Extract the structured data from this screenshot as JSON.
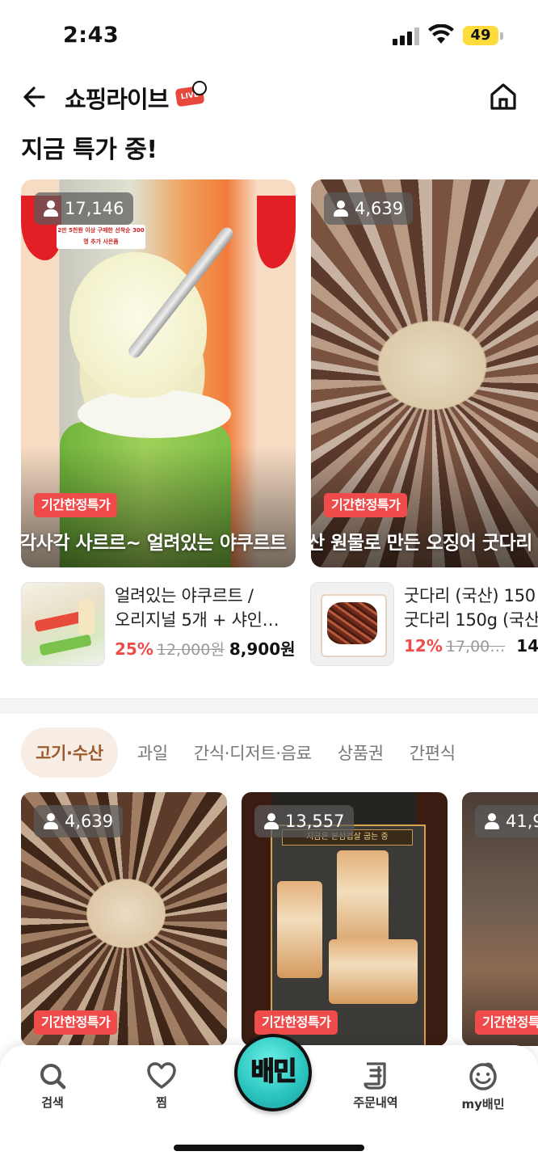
{
  "status_bar": {
    "time": "2:43",
    "battery": "49"
  },
  "header": {
    "title": "쇼핑라이브",
    "live_badge": "LIVE"
  },
  "section": {
    "title": "지금 특가 중!"
  },
  "featured": [
    {
      "viewers": "17,146",
      "badge": "기간한정특가",
      "title": "각사각 사르르~ 얼려있는 야쿠르트",
      "promo": "2만 5천원 이상 구매한 선착순 300명 추가 사은품"
    },
    {
      "viewers": "4,639",
      "badge": "기간한정특가",
      "title": "산 원물로 만든 오징어 굿다리"
    }
  ],
  "products": [
    {
      "name_line1": "얼려있는 야쿠르트 /",
      "name_line2": "오리지널 5개 + 샤인…",
      "discount": "25%",
      "original_price": "12,000원",
      "sale_price": "8,900원"
    },
    {
      "name_line1": "굿다리 (국산) 150",
      "name_line2": "굿다리 150g (국산",
      "discount": "12%",
      "original_price": "17,00…",
      "sale_price": "14,"
    }
  ],
  "tabs": [
    {
      "label": "고기·수산",
      "active": true
    },
    {
      "label": "과일"
    },
    {
      "label": "간식·디저트·음료"
    },
    {
      "label": "상품권"
    },
    {
      "label": "간편식"
    }
  ],
  "live_cards": [
    {
      "viewers": "4,639",
      "badge": "기간한정특가"
    },
    {
      "viewers": "13,557",
      "badge": "기간한정특가",
      "overlay": "지금은 본삼겹살 굽는 중"
    },
    {
      "viewers": "41,9",
      "badge": "기간한정특가"
    }
  ],
  "bottom_nav": {
    "search": "검색",
    "wishlist": "찜",
    "center": "배민",
    "orders": "주문내역",
    "my": "my배민"
  },
  "colors": {
    "accent_red": "#f04b4b",
    "tab_active_bg": "#f7ede4",
    "tab_active_text": "#9c5a2e",
    "baemin_mint": "#2cc7c0"
  }
}
